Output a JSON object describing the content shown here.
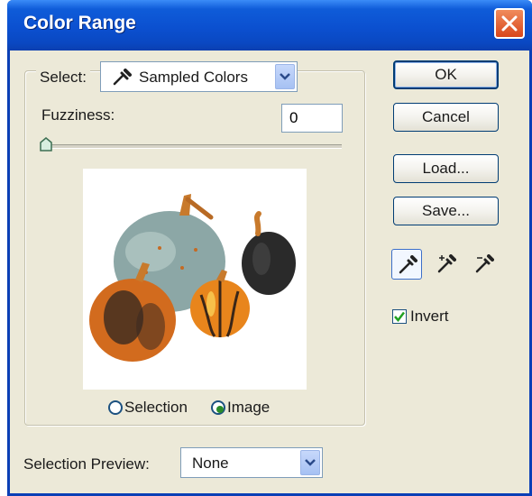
{
  "window": {
    "title": "Color Range"
  },
  "select": {
    "label": "Select:",
    "value": "Sampled Colors"
  },
  "fuzziness": {
    "label": "Fuzziness:",
    "value": "0",
    "slider_fraction": 0.0
  },
  "view_options": [
    {
      "label": "Selection",
      "selected": false
    },
    {
      "label": "Image",
      "selected": true
    }
  ],
  "selection_preview": {
    "label": "Selection Preview:",
    "value": "None"
  },
  "buttons": {
    "ok": "OK",
    "cancel": "Cancel",
    "load": "Load...",
    "save": "Save..."
  },
  "tools": [
    {
      "icon": "eyedropper-icon",
      "active": true
    },
    {
      "icon": "eyedropper-plus-icon",
      "active": false
    },
    {
      "icon": "eyedropper-minus-icon",
      "active": false
    }
  ],
  "invert": {
    "label": "Invert",
    "checked": true
  },
  "colors": {
    "title_bar": "#0a48c2",
    "dialog_bg": "#ece9d8",
    "close_button": "#d9461b",
    "radio_dot": "#2a8b2a"
  }
}
